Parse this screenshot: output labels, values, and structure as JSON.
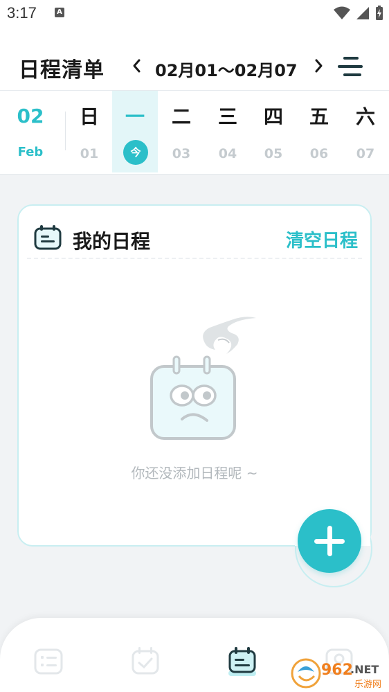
{
  "status_bar": {
    "time": "3:17",
    "notification": "A"
  },
  "header": {
    "title": "日程清单",
    "date_range": "02月01～02月07"
  },
  "week": {
    "month_num": "02",
    "month_name": "Feb",
    "days": [
      {
        "name": "日",
        "num": "01",
        "active": false
      },
      {
        "name": "一",
        "num": "今",
        "active": true
      },
      {
        "name": "二",
        "num": "03",
        "active": false
      },
      {
        "name": "三",
        "num": "04",
        "active": false
      },
      {
        "name": "四",
        "num": "05",
        "active": false
      },
      {
        "name": "五",
        "num": "06",
        "active": false
      },
      {
        "name": "六",
        "num": "07",
        "active": false
      }
    ]
  },
  "schedule_card": {
    "title": "我的日程",
    "clear_label": "清空日程",
    "empty_text": "你还没添加日程呢 ~"
  },
  "watermark": {
    "brand": "962",
    "suffix": ".NET",
    "subtitle": "乐游网"
  },
  "colors": {
    "accent": "#2bbfc9",
    "accent_light": "#e3f6f8",
    "card_border": "#c8eef1"
  }
}
